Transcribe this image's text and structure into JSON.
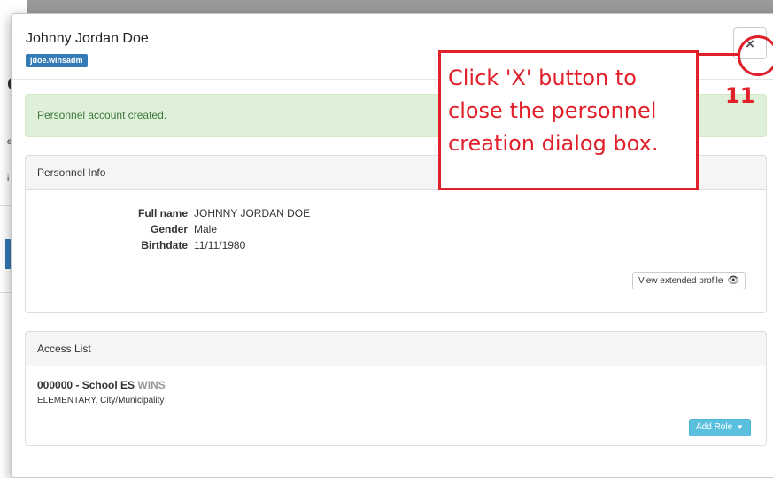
{
  "modal": {
    "title": "Johnny Jordan Doe",
    "username_badge": "jdoe.winsadm",
    "close_icon": "×"
  },
  "alert": {
    "message": "Personnel account created."
  },
  "personnel_info": {
    "heading": "Personnel Info",
    "fields": [
      {
        "label": "Full name",
        "value": "JOHNNY JORDAN DOE"
      },
      {
        "label": "Gender",
        "value": "Male"
      },
      {
        "label": "Birthdate",
        "value": "11/11/1980"
      }
    ],
    "profile_button_label": "View extended profile",
    "profile_button_icon": "eye-icon"
  },
  "access_list": {
    "heading": "Access List",
    "school_name": "000000 - School ES",
    "school_tag": "WINS",
    "school_details": "ELEMENTARY, City/Municipality",
    "add_role_label": "Add Role",
    "add_role_icon": "caret-down-icon"
  },
  "annotation": {
    "instruction": "Click 'X' button to\nclose the personnel\ncreation dialog box.",
    "step": "11",
    "color": "#e0202a"
  },
  "colors": {
    "primary": "#337ab7",
    "success_bg": "#dff0d8",
    "success_text": "#3c763d",
    "info_button": "#5bc0de"
  }
}
